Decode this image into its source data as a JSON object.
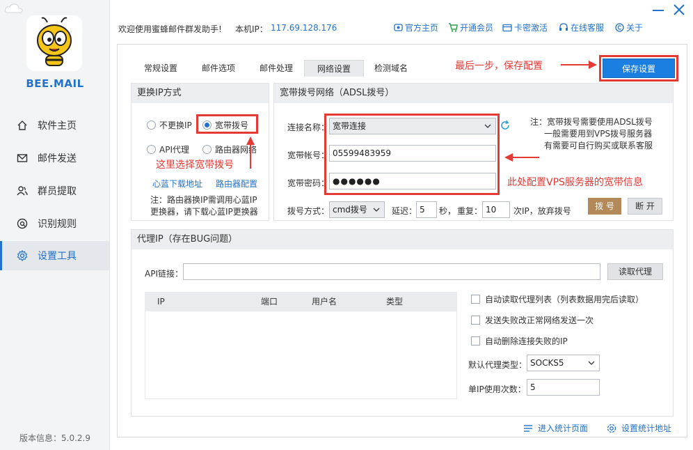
{
  "sidebar": {
    "brand": "BEE.MAIL",
    "items": [
      {
        "label": "软件主页",
        "icon": "home-icon"
      },
      {
        "label": "邮件发送",
        "icon": "mail-icon"
      },
      {
        "label": "群员提取",
        "icon": "users-icon"
      },
      {
        "label": "识别规则",
        "icon": "rule-icon"
      },
      {
        "label": "设置工具",
        "icon": "gear-icon",
        "active": true
      }
    ],
    "version": "版本信息：5.0.2.9"
  },
  "topbar": {
    "welcome": "欢迎使用蜜蜂邮件群发助手!",
    "ip_label": "本机IP：",
    "ip_value": "117.69.128.176",
    "links": [
      "官方主页",
      "开通会员",
      "卡密激活",
      "在线客服",
      "关于"
    ]
  },
  "tabs": [
    "常规设置",
    "邮件选项",
    "邮件处理",
    "网络设置",
    "检测域名"
  ],
  "active_tab": "网络设置",
  "save_button": "保存设置",
  "annotations": {
    "save": "最后一步，保存配置",
    "choose": "这里选择宽带拨号",
    "vps": "此处配置VPS服务器的宽带信息"
  },
  "ip_method": {
    "title": "更换IP方式",
    "options": [
      "不更换IP",
      "宽带拨号",
      "API代理",
      "路由器网络"
    ],
    "selected": "宽带拨号",
    "links": [
      "心蓝下载地址",
      "路由器配置"
    ],
    "note": "注：路由器换IP需调用心蓝IP更换器，请下载心蓝IP更换器"
  },
  "adsl": {
    "title": "宽带拨号网络（ADSL拨号）",
    "conn_label": "连接名称：",
    "conn_value": "宽带连接",
    "account_label": "宽带帐号：",
    "account_value": "05599483959",
    "password_label": "宽带密码：",
    "password_value": "●●●●●●",
    "note_lines": [
      "注：宽带拨号需要使用ADSL拨号",
      "一般需要用到VPS拨号服务器",
      "有需要可自行购买或联系客服"
    ],
    "dial_mode_label": "拨号方式：",
    "dial_mode_value": "cmd拨号",
    "delay_label": "延迟：",
    "delay_value": "5",
    "seconds_label": "秒，",
    "repeat_label": "重复：",
    "repeat_value": "10",
    "repeat_suffix": "次IP，放弃拨号",
    "dial_button": "拨 号",
    "disconnect_button": "断 开"
  },
  "proxy": {
    "title": "代理IP（存在BUG问题）",
    "api_label": "API链接：",
    "api_value": "",
    "read_button": "读取代理",
    "columns": [
      "IP",
      "端口",
      "用户名",
      "类型"
    ],
    "checks": [
      "自动读取代理列表（列表数据用完后读取）",
      "发送失败改正常网络发送一次",
      "自动删除连接失败的IP"
    ],
    "type_label": "默认代理类型：",
    "type_value": "SOCKS5",
    "uses_label": "单IP使用次数：",
    "uses_value": "5"
  },
  "footer": {
    "stats_page": "进入统计页面",
    "stats_url": "设置统计地址"
  }
}
